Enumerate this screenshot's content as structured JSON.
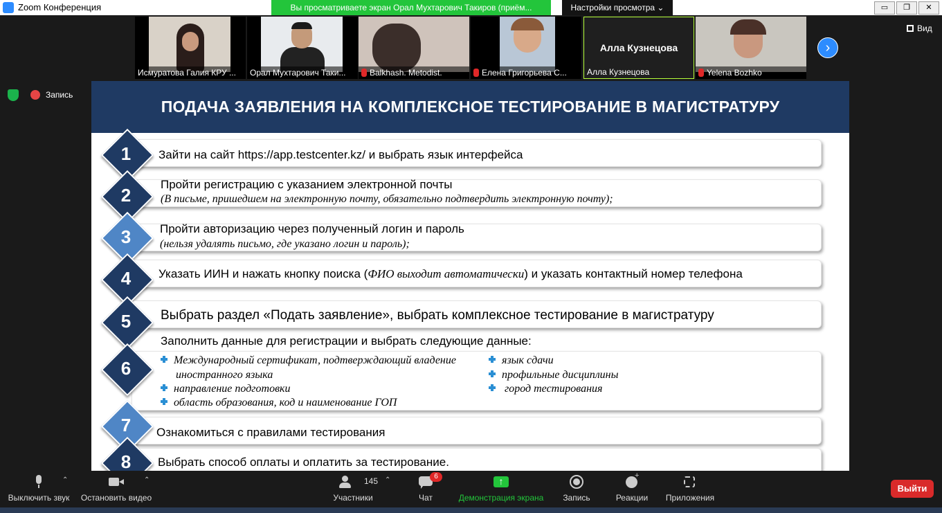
{
  "window": {
    "title": "Zoom Конференция",
    "share_banner": "Вы просматриваете экран Орал Мухтарович Такиров (приём...",
    "view_settings": "Настройки просмотра ⌄",
    "btn_minimize": "▭",
    "btn_restore": "❐",
    "btn_close": "✕"
  },
  "gallery": {
    "participants": [
      {
        "name": "Исмуратова Галия КРУ ...",
        "muted": false
      },
      {
        "name": "Орал Мухтарович Таки...",
        "muted": false
      },
      {
        "name": "Balkhash. Metodist.",
        "muted": true
      },
      {
        "name": "Елена Григорьева С...",
        "muted": true
      },
      {
        "name": "Алла Кузнецова",
        "muted": false,
        "big_name": "Алла Кузнецова"
      },
      {
        "name": "Yelena Bozhko",
        "muted": true
      }
    ],
    "next_icon": "›",
    "view_label": "Вид"
  },
  "recording": {
    "label": "Запись"
  },
  "slide": {
    "title": "ПОДАЧА ЗАЯВЛЕНИЯ НА КОМПЛЕКСНОЕ  ТЕСТИРОВАНИЕ В МАГИСТРАТУРУ",
    "steps": [
      {
        "num": "1",
        "text": "Зайти на сайт https://app.testcenter.kz/  и выбрать язык интерфейса"
      },
      {
        "num": "2",
        "text": "Пройти регистрацию с указанием электронной почты",
        "sub": "(В письме, пришедшем на электронную почту, обязательно подтвердить электронную почту);"
      },
      {
        "num": "3",
        "text": "Пройти авторизацию через полученный логин и пароль",
        "sub": "(нельзя удалять письмо, где указано логин и пароль);"
      },
      {
        "num": "4",
        "text_a": "Указать ИИН и нажать кнопку поиска (",
        "text_italic": "ФИО выходит автоматически",
        "text_b": ") и указать  контактный номер телефона"
      },
      {
        "num": "5",
        "text": "Выбрать раздел «Подать заявление», выбрать комплексное тестирование в магистратуру"
      },
      {
        "num": "6",
        "intro": "Заполнить данные для регистрации и выбрать следующие данные:",
        "bullets_left": [
          "Международный сертификат, подтверждающий владение",
          "иностранного языка",
          "направление подготовки",
          "область образования, код и наименование ГОП"
        ],
        "bullets_right": [
          "язык сдачи",
          "профильные дисциплины",
          " город тестирования"
        ]
      },
      {
        "num": "7",
        "text": "Ознакомиться с правилами тестирования"
      },
      {
        "num": "8",
        "text": "Выбрать способ оплаты и оплатить за тестирование."
      }
    ]
  },
  "toolbar": {
    "mute": "Выключить звук",
    "video": "Остановить видео",
    "participants": "Участники",
    "participants_count": "145",
    "chat": "Чат",
    "chat_badge": "6",
    "share": "Демонстрация экрана",
    "record": "Запись",
    "reactions": "Реакции",
    "apps": "Приложения",
    "leave": "Выйти",
    "caret": "⌃"
  },
  "colors": {
    "slide_header": "#1f3a63",
    "badge_dark": "#1f3a63",
    "badge_light": "#4f86c6",
    "share_green": "#23c53b",
    "leave_red": "#d92a2a"
  }
}
